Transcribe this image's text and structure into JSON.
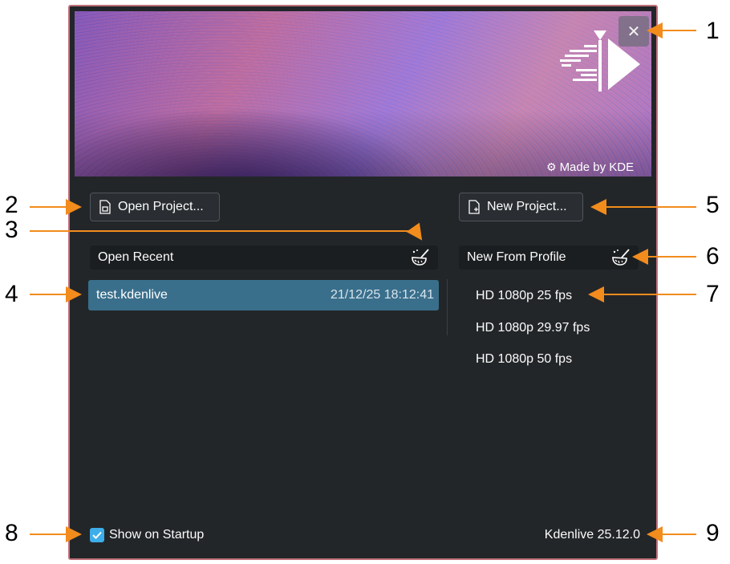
{
  "banner": {
    "made_by": "Made by KDE"
  },
  "buttons": {
    "open_project": "Open Project...",
    "new_project": "New Project..."
  },
  "recent": {
    "header": "Open Recent",
    "items": [
      {
        "name": "test.kdenlive",
        "date": "21/12/25 18:12:41"
      }
    ]
  },
  "profiles": {
    "header": "New From Profile",
    "items": [
      "HD 1080p 25 fps",
      "HD 1080p 29.97 fps",
      "HD 1080p 50 fps"
    ]
  },
  "footer": {
    "show_on_startup": "Show on Startup",
    "show_on_startup_checked": true,
    "version": "Kdenlive 25.12.0"
  },
  "callouts": [
    "1",
    "2",
    "3",
    "4",
    "5",
    "6",
    "7",
    "8",
    "9"
  ],
  "colors": {
    "accent": "#3daee9",
    "selection": "#3a6f8c",
    "background": "#232629",
    "arrow": "#f28c1c"
  }
}
